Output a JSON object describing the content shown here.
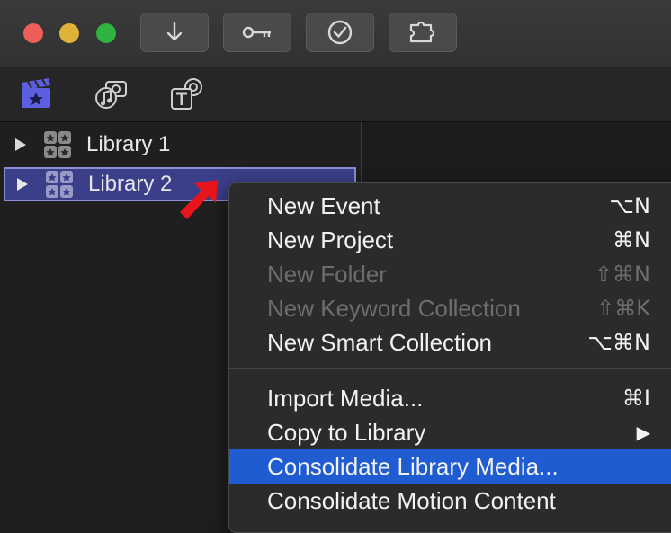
{
  "library_list": [
    {
      "label": "Library 1",
      "selected": false
    },
    {
      "label": "Library 2",
      "selected": true
    }
  ],
  "toolbar": {
    "buttons": [
      "import-icon",
      "key-icon",
      "checkmark-icon",
      "puzzle-icon"
    ]
  },
  "browser_tabs": [
    "libraries-icon",
    "photos-audio-icon",
    "titles-generators-icon"
  ],
  "context_menu": {
    "items": [
      {
        "label": "New Event",
        "shortcut": "⌥N",
        "enabled": true
      },
      {
        "label": "New Project",
        "shortcut": "⌘N",
        "enabled": true
      },
      {
        "label": "New Folder",
        "shortcut": "⇧⌘N",
        "enabled": false
      },
      {
        "label": "New Keyword Collection",
        "shortcut": "⇧⌘K",
        "enabled": false
      },
      {
        "label": "New Smart Collection",
        "shortcut": "⌥⌘N",
        "enabled": true
      },
      {
        "label": "Import Media...",
        "shortcut": "⌘I",
        "enabled": true
      },
      {
        "label": "Copy to Library",
        "shortcut": "▶",
        "enabled": true
      },
      {
        "label": "Consolidate Library Media...",
        "shortcut": "",
        "enabled": true,
        "highlighted": true
      },
      {
        "label": "Consolidate Motion Content",
        "shortcut": "",
        "enabled": true
      }
    ]
  },
  "colors": {
    "selection": "#3b3f8a",
    "menu_highlight": "#1f5bd1",
    "annotation_arrow": "#e8141b"
  }
}
